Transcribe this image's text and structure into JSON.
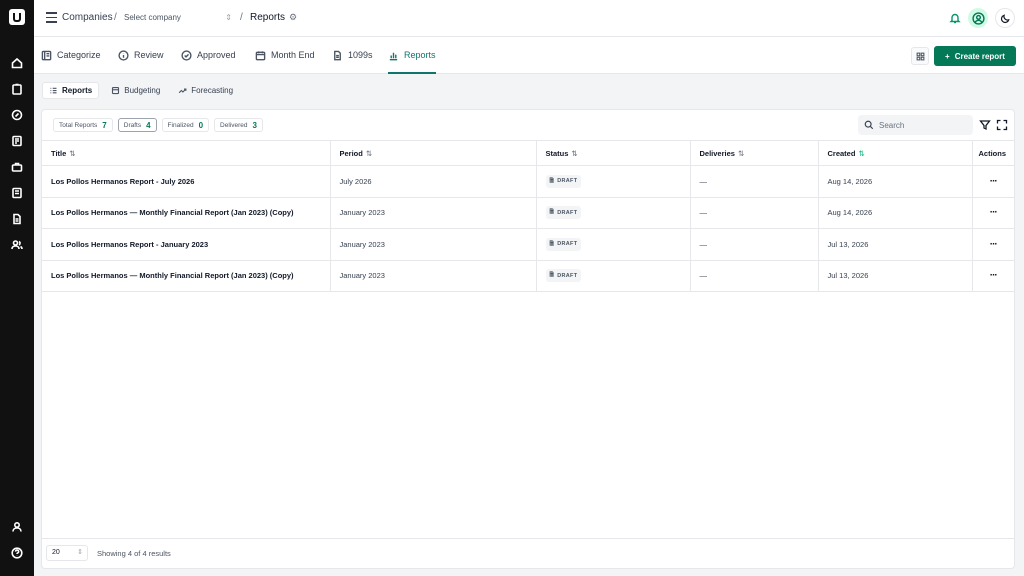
{
  "breadcrumb": {
    "companies": "Companies",
    "separator": "/",
    "company_select_placeholder": "Select company",
    "current": "Reports"
  },
  "tabs": [
    {
      "label": "Categorize",
      "icon": "categorize-icon"
    },
    {
      "label": "Review",
      "icon": "info-icon"
    },
    {
      "label": "Approved",
      "icon": "check-circle-icon"
    },
    {
      "label": "Month End",
      "icon": "calendar-icon"
    },
    {
      "label": "1099s",
      "icon": "document-icon"
    },
    {
      "label": "Reports",
      "icon": "bar-chart-icon",
      "active": true
    }
  ],
  "actions": {
    "create_report": "Create report"
  },
  "subtabs": [
    {
      "label": "Reports",
      "active": true
    },
    {
      "label": "Budgeting"
    },
    {
      "label": "Forecasting"
    }
  ],
  "chips": [
    {
      "label": "Total Reports",
      "count": "7"
    },
    {
      "label": "Drafts",
      "count": "4",
      "active": true
    },
    {
      "label": "Finalized",
      "count": "0"
    },
    {
      "label": "Delivered",
      "count": "3"
    }
  ],
  "search": {
    "placeholder": "Search"
  },
  "table": {
    "columns": [
      "Title",
      "Period",
      "Status",
      "Deliveries",
      "Created",
      "Actions"
    ],
    "rows": [
      {
        "title": "Los Pollos Hermanos Report - July 2026",
        "period": "July 2026",
        "status": "DRAFT",
        "deliveries": "—",
        "created": "Aug 14, 2026"
      },
      {
        "title": "Los Pollos Hermanos — Monthly Financial Report (Jan 2023) (Copy)",
        "period": "January 2023",
        "status": "DRAFT",
        "deliveries": "—",
        "created": "Aug 14, 2026"
      },
      {
        "title": "Los Pollos Hermanos Report - January 2023",
        "period": "January 2023",
        "status": "DRAFT",
        "deliveries": "—",
        "created": "Jul 13, 2026"
      },
      {
        "title": "Los Pollos Hermanos — Monthly Financial Report (Jan 2023) (Copy)",
        "period": "January 2023",
        "status": "DRAFT",
        "deliveries": "—",
        "created": "Jul 13, 2026"
      }
    ]
  },
  "footer": {
    "page_size": "20",
    "showing": "Showing 4 of 4 results"
  },
  "colors": {
    "accent": "#047857",
    "active_tab": "#0f766e",
    "rail": "#111111"
  }
}
